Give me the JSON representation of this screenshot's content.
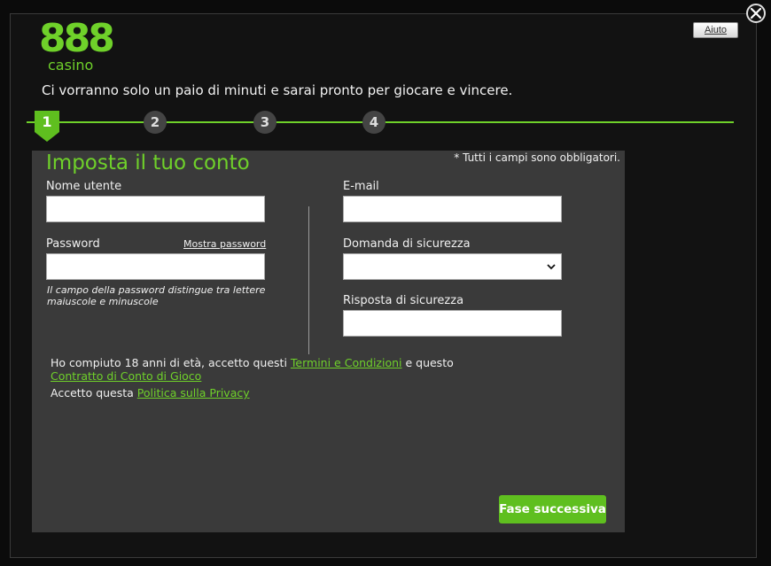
{
  "window": {
    "help_label": "Aiuto",
    "close_icon": "close-icon"
  },
  "logo": {
    "number": "888",
    "word": "casino",
    "color": "#6fd12a"
  },
  "tagline": "Ci vorranno solo un paio di minuti e sarai pronto per giocare e vincere.",
  "steps": {
    "current": 1,
    "labels": [
      "1",
      "2",
      "3",
      "4"
    ]
  },
  "form": {
    "title": "Imposta il tuo conto",
    "required_note": "* Tutti i campi sono obbligatori.",
    "username": {
      "label": "Nome utente",
      "value": ""
    },
    "password": {
      "label": "Password",
      "value": "",
      "show_label": "Mostra password",
      "hint": "Il campo della password distingue tra lettere maiuscole e minuscole"
    },
    "email": {
      "label": "E-mail",
      "value": ""
    },
    "security_question": {
      "label": "Domanda di sicurezza",
      "selected": ""
    },
    "security_answer": {
      "label": "Risposta di sicurezza",
      "value": ""
    },
    "terms": {
      "line1_pre": "Ho compiuto 18 anni di età, accetto questi ",
      "terms_link": "Termini e Condizioni",
      "line1_post": " e questo",
      "contract_link": "Contratto di Conto di Gioco",
      "privacy_pre": "Accetto questa ",
      "privacy_link": "Politica sulla Privacy"
    },
    "next_label": "Fase successiva"
  },
  "colors": {
    "accent": "#6fd12a",
    "panel": "#3a3a3a",
    "button": "#5fbf1f"
  }
}
